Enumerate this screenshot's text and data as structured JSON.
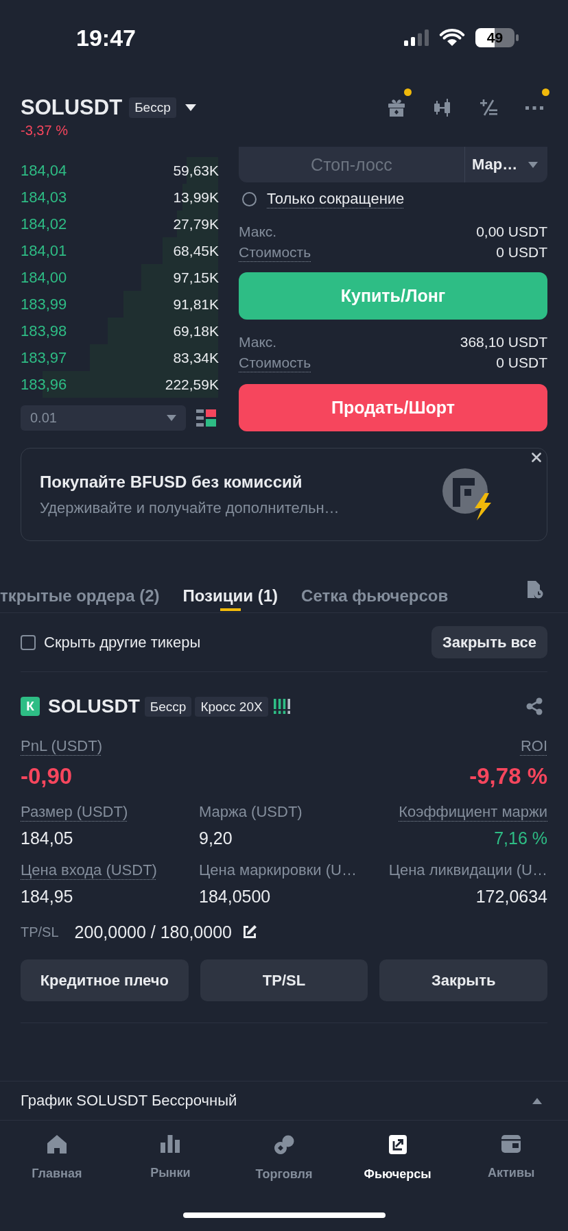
{
  "status_bar": {
    "time": "19:47",
    "battery": "49"
  },
  "header": {
    "symbol": "SOLUSDT",
    "tag": "Бесср",
    "change": "-3,37 %",
    "actions": [
      {
        "dot": true
      },
      {
        "dot": false
      },
      {
        "dot": false
      },
      {
        "dot": true
      }
    ]
  },
  "order_book": {
    "rows": [
      {
        "price": "184,04",
        "amount": "59,63K",
        "level": 0.16
      },
      {
        "price": "184,03",
        "amount": "13,99K",
        "level": 0.18
      },
      {
        "price": "184,02",
        "amount": "27,79K",
        "level": 0.21
      },
      {
        "price": "184,01",
        "amount": "68,45K",
        "level": 0.28
      },
      {
        "price": "184,00",
        "amount": "97,15K",
        "level": 0.39
      },
      {
        "price": "183,99",
        "amount": "91,81K",
        "level": 0.48
      },
      {
        "price": "183,98",
        "amount": "69,18K",
        "level": 0.56
      },
      {
        "price": "183,97",
        "amount": "83,34K",
        "level": 0.65
      },
      {
        "price": "183,96",
        "amount": "222,59K",
        "level": 0.89
      }
    ],
    "step": "0.01"
  },
  "order_form": {
    "stop_loss": {
      "placeholder": "Стоп-лосс"
    },
    "order_type": "Мар…",
    "reduce_only": {
      "label": "Только сокращение",
      "checked": false
    },
    "buy": {
      "info": [
        {
          "label": "Макс.",
          "value": "0,00 USDT",
          "hint": false
        },
        {
          "label": "Стоимость",
          "value": "0 USDT",
          "hint": true
        }
      ],
      "button": "Купить/Лонг"
    },
    "sell": {
      "info": [
        {
          "label": "Макс.",
          "value": "368,10 USDT",
          "hint": false
        },
        {
          "label": "Стоимость",
          "value": "0 USDT",
          "hint": true
        }
      ],
      "button": "Продать/Шорт"
    }
  },
  "promo": {
    "title": "Покупайте BFUSD без комиссий",
    "subtitle": "Удерживайте и получайте дополнительн…"
  },
  "tabs": [
    {
      "label": "ткрытые ордера (2)",
      "selected": false
    },
    {
      "label": "Позиции (1)",
      "selected": true
    },
    {
      "label": "Сетка фьючерсов",
      "selected": false
    }
  ],
  "filter": {
    "label": "Скрыть другие тикеры",
    "checked": false,
    "button": "Закрыть все"
  },
  "position": {
    "side": "К",
    "symbol": "SOLUSDT",
    "tags": [
      "Бесср",
      "Кросс 20X"
    ],
    "headline": [
      {
        "label": "PnL (USDT)",
        "value": "-0,90",
        "color": "#f6465d",
        "hint": true
      },
      {
        "label": "ROI",
        "value": "-9,78 %",
        "color": "#f6465d",
        "hint": true
      }
    ],
    "metrics": [
      {
        "label": "Размер (USDT)",
        "value": "184,05",
        "color": "#eaecef",
        "hint": true
      },
      {
        "label": "Маржа (USDT)",
        "value": "9,20",
        "color": "#eaecef",
        "hint": false
      },
      {
        "label": "Коэффициент маржи",
        "value": "7,16 %",
        "color": "#2ebd85",
        "hint": true
      },
      {
        "label": "Цена входа (USDT)",
        "value": "184,95",
        "color": "#eaecef",
        "hint": true
      },
      {
        "label": "Цена маркировки (U…",
        "value": "184,0500",
        "color": "#eaecef",
        "hint": false
      },
      {
        "label": "Цена ликвидации (U…",
        "value": "172,0634",
        "color": "#eaecef",
        "hint": false
      }
    ],
    "tpsl": {
      "label": "TP/SL",
      "value": "200,0000 / 180,0000"
    },
    "actions": [
      "Кредитное плечо",
      "TP/SL",
      "Закрыть"
    ]
  },
  "chart_bar": {
    "title": "График SOLUSDT Бессрочный"
  },
  "bottom_nav": [
    {
      "label": "Главная",
      "selected": false
    },
    {
      "label": "Рынки",
      "selected": false
    },
    {
      "label": "Торговля",
      "selected": false
    },
    {
      "label": "Фьючерсы",
      "selected": true
    },
    {
      "label": "Активы",
      "selected": false
    }
  ]
}
